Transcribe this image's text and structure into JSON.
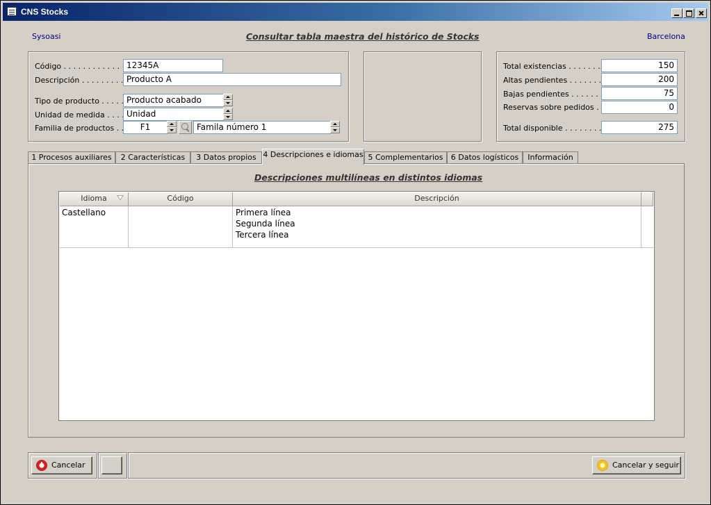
{
  "window": {
    "title": "CNS Stocks"
  },
  "header": {
    "company": "Sysoasi",
    "title": "Consultar tabla maestra del histórico de Stocks",
    "location": "Barcelona"
  },
  "product": {
    "codigo_label": "Código . . . . . . . . . . . .",
    "codigo_value": "12345A",
    "descripcion_label": "Descripción . . . . . . . . .",
    "descripcion_value": "Producto A",
    "tipo_label": "Tipo de producto . . . . .",
    "tipo_value": "Producto acabado",
    "unidad_label": "Unidad de medida . . . . .",
    "unidad_value": "Unidad",
    "familia_label": "Familia de productos . . .",
    "familia_code": "F1",
    "familia_name": "Famila número 1"
  },
  "stock": {
    "total_existencias_label": "Total existencias . . . . . . . .",
    "total_existencias": "150",
    "altas_label": "Altas pendientes . . . . . . . .",
    "altas": "200",
    "bajas_label": "Bajas pendientes . . . . . . . .",
    "bajas": "75",
    "reservas_label": "Reservas sobre pedidos . . .",
    "reservas": "0",
    "total_disponible_label": "Total disponible . . . . . . . . .",
    "total_disponible": "275"
  },
  "tabs": [
    {
      "label": "1  Procesos auxiliares"
    },
    {
      "label": "2  Características"
    },
    {
      "label": "3  Datos propios"
    },
    {
      "label": "4  Descripciones e idiomas",
      "active": true
    },
    {
      "label": "5  Complementarios"
    },
    {
      "label": "6  Datos logísticos"
    },
    {
      "label": "Información"
    }
  ],
  "panel": {
    "title": "Descripciones multilíneas en distintos idiomas",
    "columns": [
      "Idioma",
      "Código",
      "Descripción"
    ],
    "rows": [
      {
        "idioma": "Castellano",
        "codigo": "",
        "descripcion": [
          "Primera línea",
          "Segunda línea",
          "Tercera línea"
        ]
      }
    ]
  },
  "footer": {
    "cancel_label": "Cancelar",
    "cancel_continue_label": "Cancelar y seguir"
  },
  "colors": {
    "title_gradient_start": "#0a246a",
    "title_gradient_end": "#a6caf0",
    "face": "#d4d0c8",
    "link_blue": "#000080"
  }
}
